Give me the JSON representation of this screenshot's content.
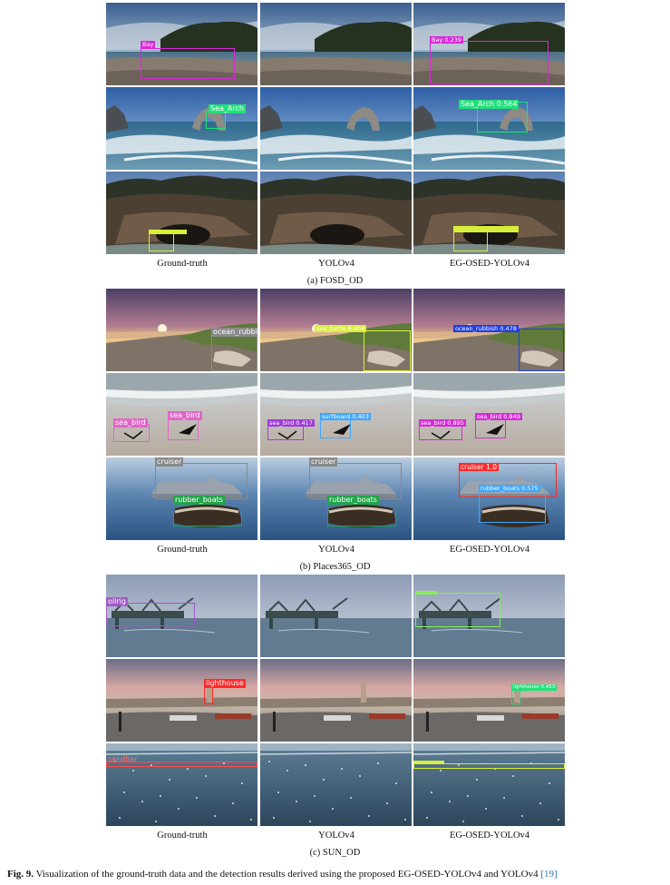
{
  "columns": [
    "Ground-truth",
    "YOLOv4",
    "EG-OSED-YOLOv4"
  ],
  "sections": [
    {
      "caption": "(a) FOSD_OD"
    },
    {
      "caption": "(b) Places365_OD"
    },
    {
      "caption": "(c) SUN_OD"
    }
  ],
  "detections": {
    "a1_gt": "Bay",
    "a1_eg": "Bay 0.239",
    "a2_gt": "Sea_Arch",
    "a2_eg": "Sea_Arch 0.564",
    "b1_gt": "ocean_rubbi",
    "b1_yolo": "sea_turtle 0.404",
    "b1_eg": "ocean_rubbish 0.478",
    "b2_gt1": "sea_bird",
    "b2_gt2": "sea_bird",
    "b2_yolo1": "sea_bird 0.417",
    "b2_yolo2": "surfboard 0.403",
    "b2_eg1": "sea_bird 0.895",
    "b2_eg2": "sea_bird 0.849",
    "b3_gt1": "cruiser",
    "b3_gt2": "rubber_boats",
    "b3_yolo1": "cruiser",
    "b3_yolo2": "rubber_boats",
    "b3_eg1": "cruiser 1.0",
    "b3_eg2": "rubber_boats 0.575",
    "c1_gt": "oilrig",
    "c2_gt": "lighthouse",
    "c2_eg": "lighthouse 0.453",
    "c3_gt": "sandbar"
  },
  "figure_caption": {
    "label": "Fig. 9.",
    "text": " Visualization of the ground-truth data and the detection results derived using the proposed EG-OSED-YOLOv4 and YOLOv4 ",
    "ref": "[19]"
  },
  "colors": {
    "magenta": "#d62ad6",
    "green": "#22e07a",
    "yellow": "#d8ee3a",
    "blue": "#1f3fe0",
    "lightblue": "#3fa7ff",
    "pink": "#e065c8",
    "gray": "#8a8a8a",
    "red": "#ff2a2a",
    "violet": "#a05ac8",
    "lime": "#88ee55"
  }
}
